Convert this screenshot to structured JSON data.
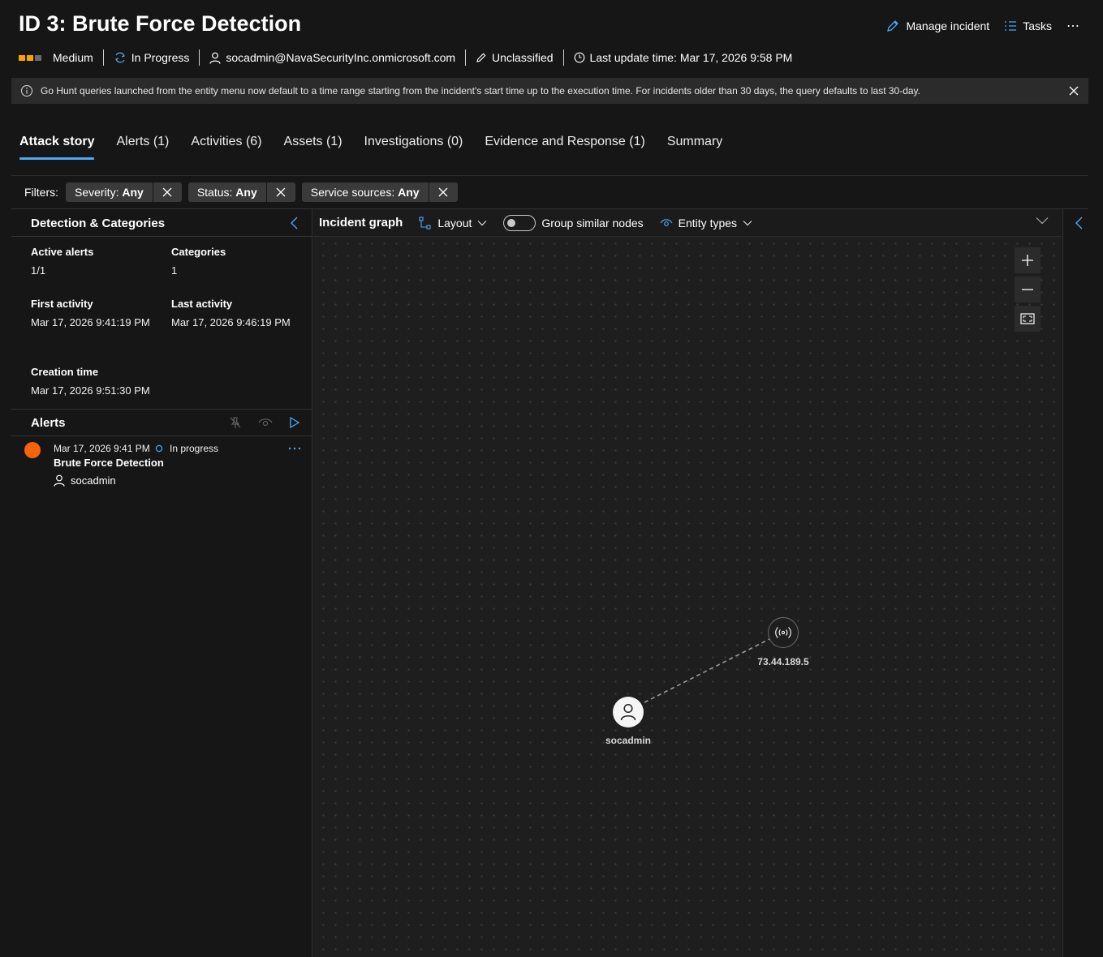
{
  "incident": {
    "title": "ID 3: Brute Force Detection",
    "severity": "Medium",
    "status": "In Progress",
    "assigned_to": "socadmin@NavaSecurityInc.onmicrosoft.com",
    "classification": "Unclassified",
    "last_update": "Last update time: Mar 17, 2026 9:58 PM"
  },
  "header_actions": {
    "manage": "Manage incident",
    "tasks": "Tasks",
    "more": "⋯"
  },
  "banner": {
    "text": "Go Hunt queries launched from the entity menu now default to a time range starting from the incident's start time up to the execution time. For incidents older than 30 days, the query defaults to last 30-day."
  },
  "tabs": [
    {
      "label": "Attack story",
      "active": true
    },
    {
      "label": "Alerts (1)"
    },
    {
      "label": "Activities (6)"
    },
    {
      "label": "Assets (1)"
    },
    {
      "label": "Investigations (0)"
    },
    {
      "label": "Evidence and Response (1)"
    },
    {
      "label": "Summary"
    }
  ],
  "filters": {
    "label": "Filters:",
    "chips": [
      {
        "key": "Severity:",
        "value": "Any"
      },
      {
        "key": "Status:",
        "value": "Any"
      },
      {
        "key": "Service sources:",
        "value": "Any"
      }
    ]
  },
  "details": {
    "heading": "Detection & Categories",
    "active_alerts_label": "Active alerts",
    "active_alerts_value": "1/1",
    "categories_label": "Categories",
    "categories_value": "1",
    "first_activity_label": "First activity",
    "first_activity_value": "Mar 17, 2026 9:41:19 PM",
    "last_activity_label": "Last activity",
    "last_activity_value": "Mar 17, 2026 9:46:19 PM",
    "creation_label": "Creation time",
    "creation_value": "Mar 17, 2026 9:51:30 PM"
  },
  "alerts": {
    "heading": "Alerts",
    "items": [
      {
        "date": "Mar 17, 2026 9:41 PM",
        "status": "In progress",
        "title": "Brute Force Detection",
        "user": "socadmin"
      }
    ]
  },
  "graph": {
    "title": "Incident graph",
    "layout_label": "Layout",
    "group_label": "Group similar nodes",
    "group_enabled": false,
    "entity_types_label": "Entity types",
    "nodes": {
      "user_label": "socadmin",
      "ip_label": "73.44.189.5"
    }
  },
  "colors": {
    "accent": "#4ea8f2",
    "severity_medium": "#f7a600",
    "alert_dot": "#f7630c",
    "background": "#161616"
  }
}
